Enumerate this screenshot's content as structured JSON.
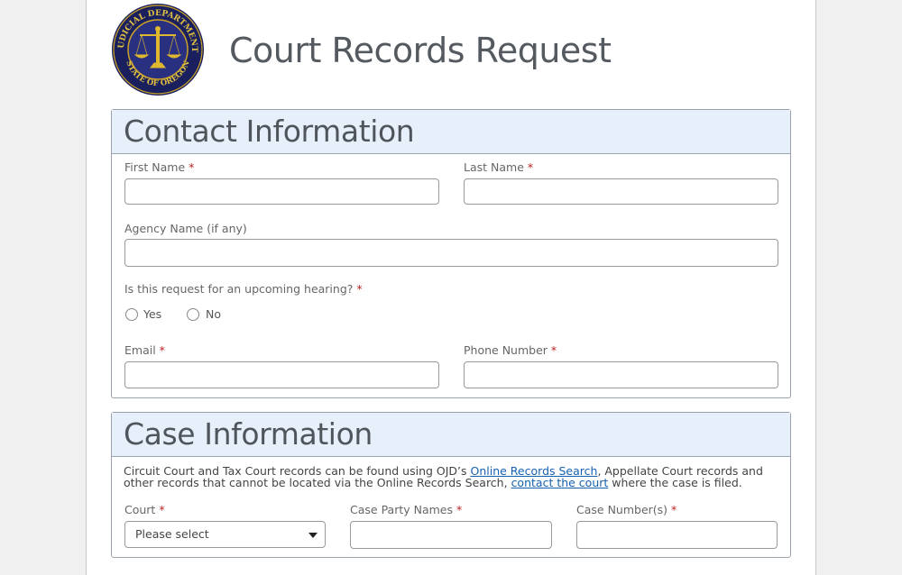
{
  "header": {
    "title": "Court Records Request",
    "seal": {
      "top_text": "JUDICIAL DEPARTMENT",
      "bottom_text": "STATE OF OREGON"
    }
  },
  "contact": {
    "heading": "Contact Information",
    "first_name": {
      "label": "First Name",
      "required": "*",
      "value": ""
    },
    "last_name": {
      "label": "Last Name",
      "required": "*",
      "value": ""
    },
    "agency": {
      "label": "Agency Name (if any)",
      "value": ""
    },
    "hearing": {
      "label": "Is this request for an upcoming hearing?",
      "required": "*",
      "options": [
        "Yes",
        "No"
      ]
    },
    "email": {
      "label": "Email",
      "required": "*",
      "value": ""
    },
    "phone": {
      "label": "Phone Number",
      "required": "*",
      "value": ""
    }
  },
  "case": {
    "heading": "Case Information",
    "note_1": "Circuit Court and Tax Court records can be found using OJD’s ",
    "link_1": "Online Records Search",
    "note_2": ", Appellate Court records and other records that cannot be located via the Online Records Search, ",
    "link_2": "contact the court",
    "note_3": " where the case is filed.",
    "court": {
      "label": "Court",
      "required": "*",
      "selected": "Please select"
    },
    "party_names": {
      "label": "Case Party Names",
      "required": "*",
      "value": ""
    },
    "case_numbers": {
      "label": "Case Number(s)",
      "required": "*",
      "value": ""
    }
  }
}
